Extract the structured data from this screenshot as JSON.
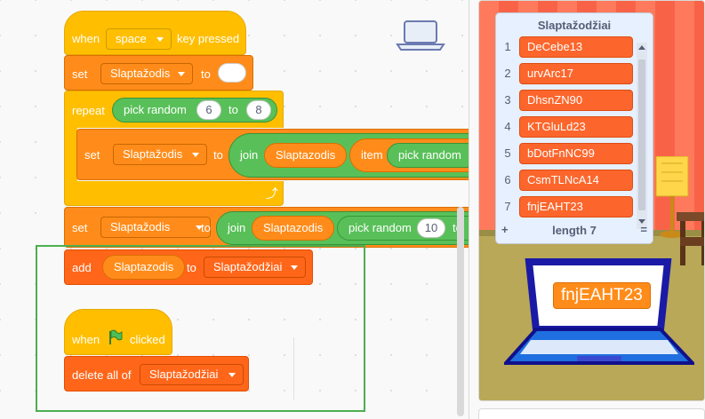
{
  "blocks": {
    "when": "when",
    "space": "space",
    "key_pressed": "key pressed",
    "set": "set",
    "var_slaptazodis": "Slaptažodis",
    "to": "to",
    "repeat": "repeat",
    "pick_random": "pick random",
    "rand_from": "6",
    "rand_to": "8",
    "join": "join",
    "var_reporter": "Slaptazodis",
    "item": "item",
    "pick_random2": "pick random",
    "rand_from2": "10",
    "to_trunc": "to",
    "add": "add",
    "list_name": "Slaptažodžiai",
    "when_flag": "when",
    "clicked": "clicked",
    "delete_all": "delete all of"
  },
  "list_monitor": {
    "title": "Slaptažodžiai",
    "items": [
      {
        "idx": "1",
        "val": "DeCebe13"
      },
      {
        "idx": "2",
        "val": "urvArc17"
      },
      {
        "idx": "3",
        "val": "DhsnZN90"
      },
      {
        "idx": "4",
        "val": "KTGluLd23"
      },
      {
        "idx": "5",
        "val": "bDotFnNC99"
      },
      {
        "idx": "6",
        "val": "CsmTLNcA14"
      },
      {
        "idx": "7",
        "val": "fnjEAHT23"
      }
    ],
    "add": "+",
    "length": "length 7",
    "equals": "="
  },
  "stage": {
    "laptop_text": "fnjEAHT23"
  },
  "colors": {
    "events": "#ffbf00",
    "variables": "#ff8c1a",
    "lists": "#ff661a",
    "operators": "#59c059",
    "selection": "#4caf50"
  }
}
